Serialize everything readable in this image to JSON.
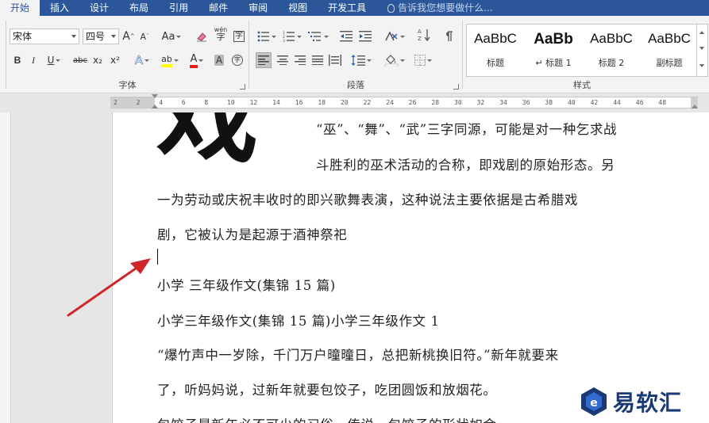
{
  "tabs": [
    "开始",
    "插入",
    "设计",
    "布局",
    "引用",
    "邮件",
    "审阅",
    "视图",
    "开发工具"
  ],
  "tell_me": "告诉我您想要做什么...",
  "font": {
    "name": "宋体",
    "size": "四号",
    "grow_label": "A",
    "shrink_label": "A",
    "case_label": "Aa",
    "bold": "B",
    "italic": "I",
    "underline": "U",
    "strike": "abc",
    "subscript": "x₂",
    "superscript": "x²",
    "effects": "A",
    "highlight": "ab",
    "color": "A",
    "shade": "A",
    "enclose": "字",
    "phonetic": "wén",
    "group_label": "字体",
    "colors": {
      "highlight": "#ffff00",
      "font_color": "#e51c1c"
    }
  },
  "paragraph": {
    "group_label": "段落"
  },
  "styles": {
    "group_label": "样式",
    "items": [
      {
        "sample": "AaBbC",
        "name": "标题",
        "bold": false
      },
      {
        "sample": "AaBb",
        "name": "↵ 标题 1",
        "bold": true
      },
      {
        "sample": "AaBbC",
        "name": "标题 2",
        "bold": false
      },
      {
        "sample": "AaBbC",
        "name": "副标题",
        "bold": false
      }
    ]
  },
  "ruler": {
    "ticks": [
      "2",
      "2",
      "4",
      "6",
      "8",
      "10",
      "12",
      "14",
      "16",
      "18",
      "20",
      "22",
      "24",
      "26",
      "28",
      "30",
      "32",
      "34",
      "36",
      "38",
      "40",
      "42",
      "44",
      "46",
      "48"
    ]
  },
  "document": {
    "dropcap": "戏",
    "lines": [
      "“巫”、“舞”、“武”三字同源，可能是对一种乞求战",
      "斗胜利的巫术活动的合称，即戏剧的原始形态。另",
      "一为劳动或庆祝丰收时的即兴歌舞表演，这种说法主要依据是古希腊戏",
      "剧，它被认为是起源于酒神祭祀",
      "小学 三年级作文(集锦 15 篇)",
      "小学三年级作文(集锦 15 篇)小学三年级作文 1",
      "“爆竹声中一岁除，千门万户曈曈日，总把新桃换旧符。”新年就要来",
      "了，听妈妈说，过新年就要包饺子，吃团圆饭和放烟花。",
      "包饺子是新年必不可少的习俗。传说，包饺子的形状如金"
    ]
  },
  "watermark": {
    "text": "易软汇",
    "color": "#1b3a75"
  },
  "annotation": {
    "arrow_color": "#d0262b"
  }
}
